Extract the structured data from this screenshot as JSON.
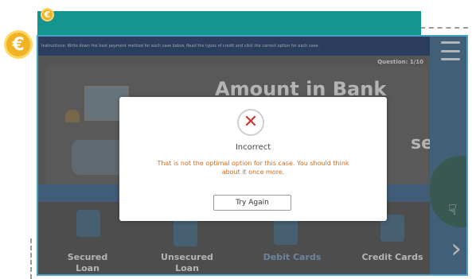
{
  "page": {
    "instruction": "Instructions: Write down the best payment method for each case below. Read the types of credit and click the correct option for each case.",
    "question_counter": "Question: 1/10",
    "title": "Amount in Bank",
    "title_fragment": "se",
    "coin_symbol": "€"
  },
  "options": [
    {
      "label_line1": "Secured",
      "label_line2": "Loan",
      "selected": false
    },
    {
      "label_line1": "Unsecured",
      "label_line2": "Loan",
      "selected": false
    },
    {
      "label_line1": "Debit Cards",
      "label_line2": "",
      "selected": true
    },
    {
      "label_line1": "Credit Cards",
      "label_line2": "",
      "selected": false
    }
  ],
  "modal": {
    "icon": "close-icon",
    "title": "Incorrect",
    "message": "That is not the optimal option for this case. You should think about it once more.",
    "button": "Try Again"
  },
  "colors": {
    "teal_panel": "#15958f",
    "coin": "#f0b323",
    "error_red": "#c93333",
    "message_orange": "#d06a1a"
  }
}
